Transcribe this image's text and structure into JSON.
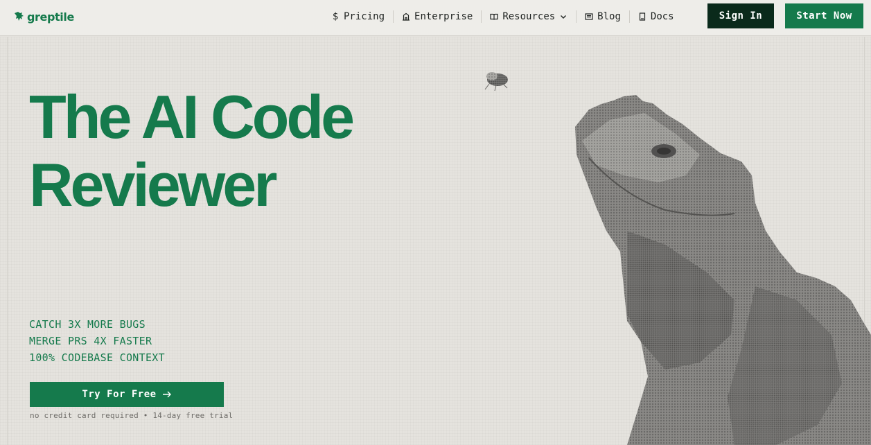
{
  "brand": {
    "name": "greptile",
    "color": "#157a4c",
    "dark": "#0a2a1b",
    "background": "#e5e3de"
  },
  "nav": {
    "items": [
      {
        "label": "Pricing",
        "icon": "dollar-icon",
        "glyph": "$"
      },
      {
        "label": "Enterprise",
        "icon": "building-icon"
      },
      {
        "label": "Resources",
        "icon": "book-icon",
        "dropdown": true
      },
      {
        "label": "Blog",
        "icon": "newspaper-icon"
      },
      {
        "label": "Docs",
        "icon": "document-icon"
      }
    ],
    "sign_in": "Sign In",
    "start_now": "Start Now"
  },
  "hero": {
    "headline_line1": "The AI Code",
    "headline_line2": "Reviewer",
    "features": [
      "CATCH 3X MORE BUGS",
      "MERGE PRS 4X FASTER",
      "100% CODEBASE CONTEXT"
    ],
    "cta": "Try For Free",
    "cta_icon": "arrow-right-icon",
    "note": "no credit card required • 14-day free trial",
    "illustration": "halftone-lizard-illustration"
  }
}
